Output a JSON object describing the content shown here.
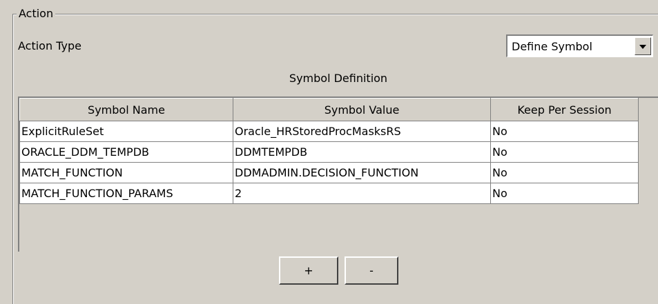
{
  "group": {
    "legend": "Action"
  },
  "action_type": {
    "label": "Action Type",
    "selected": "Define Symbol"
  },
  "section_title": "Symbol Definition",
  "table": {
    "columns": [
      "Symbol Name",
      "Symbol Value",
      "Keep Per Session"
    ],
    "rows": [
      [
        "ExplicitRuleSet",
        "Oracle_HRStoredProcMasksRS",
        "No"
      ],
      [
        "ORACLE_DDM_TEMPDB",
        "DDMTEMPDB",
        "No"
      ],
      [
        "MATCH_FUNCTION",
        "DDMADMIN.DECISION_FUNCTION",
        "No"
      ],
      [
        "MATCH_FUNCTION_PARAMS",
        "2",
        "No"
      ]
    ]
  },
  "buttons": {
    "add": "+",
    "remove": "-"
  }
}
